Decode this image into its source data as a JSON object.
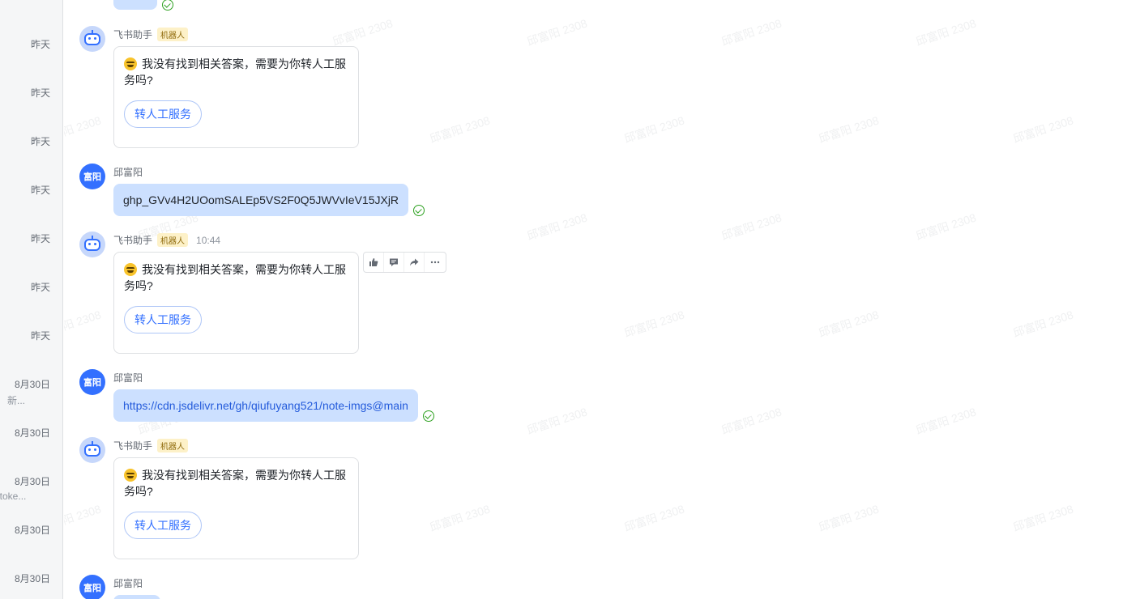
{
  "left_list": {
    "items": [
      {
        "date": "昨天",
        "snippet": ""
      },
      {
        "date": "昨天",
        "snippet": ""
      },
      {
        "date": "昨天",
        "snippet": ""
      },
      {
        "date": "昨天",
        "snippet": ""
      },
      {
        "date": "昨天",
        "snippet": ""
      },
      {
        "date": "昨天",
        "snippet": ""
      },
      {
        "date": "昨天",
        "snippet": ""
      },
      {
        "date": "8月30日",
        "snippet": "新..."
      },
      {
        "date": "8月30日",
        "snippet": ""
      },
      {
        "date": "8月30日",
        "snippet": "gtoke..."
      },
      {
        "date": "8月30日",
        "snippet": ""
      },
      {
        "date": "8月30日",
        "snippet": ""
      }
    ]
  },
  "watermark_text": "邱富阳 2308",
  "bot": {
    "name": "飞书助手",
    "tag": "机器人",
    "reply_text": "我没有找到相关答案，需要为你转人工服务吗?",
    "button_label": "转人工服务"
  },
  "user": {
    "name": "邱富阳",
    "avatar_text": "富阳"
  },
  "messages": {
    "m2_time": "10:44",
    "user_msg_1": "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",
    "user_msg_2": "https://cdn.jsdelivr.net/gh/qiufuyang521/note-imgs@main"
  },
  "toolbar": {
    "like_icon": "thumbs-up-icon",
    "reply_icon": "comment-icon",
    "forward_icon": "forward-icon",
    "more_icon": "more-icon"
  },
  "colors": {
    "accent": "#3370ff",
    "bubble": "#cce0ff",
    "read": "#2ea121"
  }
}
